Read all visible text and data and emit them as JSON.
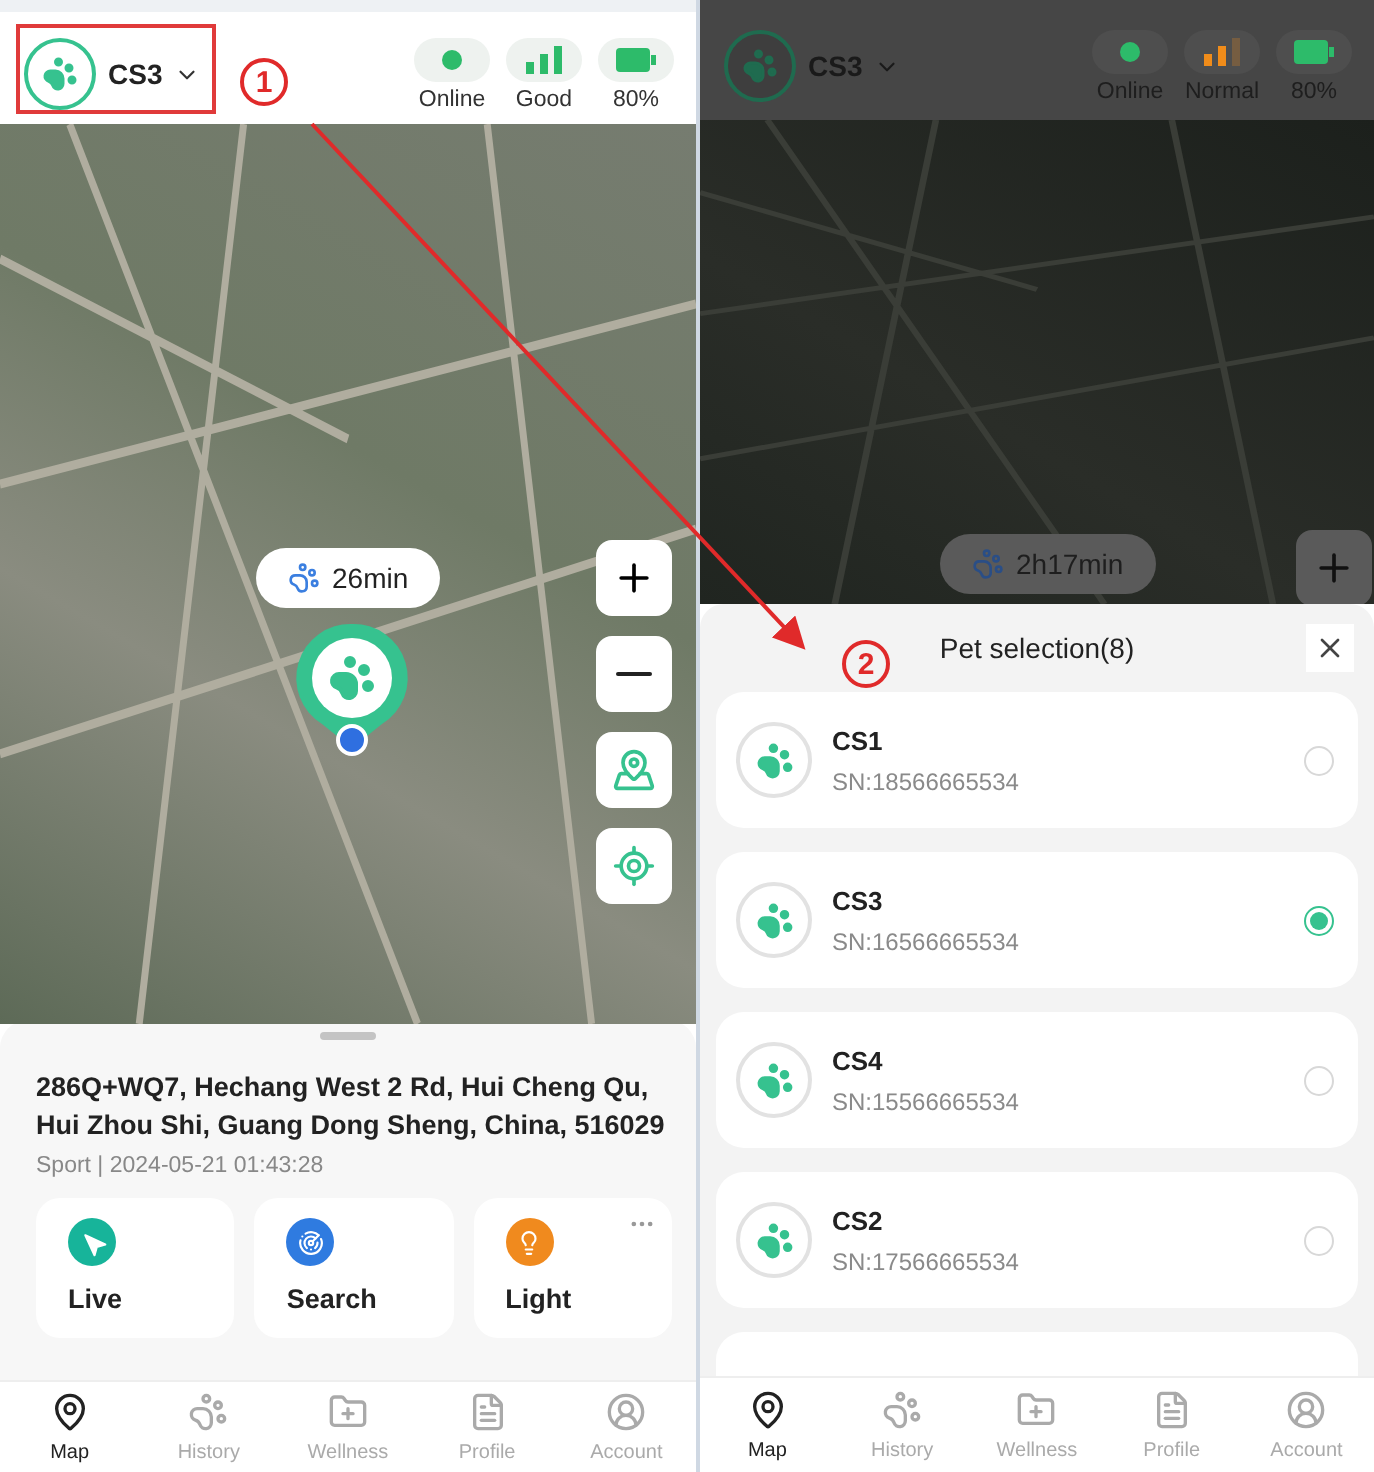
{
  "annotations": [
    {
      "label": "1"
    },
    {
      "label": "2"
    }
  ],
  "left_screen": {
    "header": {
      "pet_name": "CS3",
      "status": [
        {
          "kind": "dot",
          "label": "Online",
          "color": "#2dbb6a"
        },
        {
          "kind": "signal",
          "label": "Good",
          "color": "#2dbb6a"
        },
        {
          "kind": "battery",
          "label": "80%",
          "color": "#2dbb6a"
        }
      ]
    },
    "map": {
      "duration": "26min"
    },
    "sheet": {
      "address": "286Q+WQ7, Hechang West 2 Rd, Hui Cheng Qu, Hui Zhou Shi, Guang Dong Sheng, China, 516029",
      "meta": "Sport | 2024-05-21 01:43:28",
      "actions": [
        {
          "kind": "live",
          "label": "Live"
        },
        {
          "kind": "search",
          "label": "Search"
        },
        {
          "kind": "light",
          "label": "Light"
        }
      ]
    },
    "nav": [
      {
        "kind": "map",
        "label": "Map",
        "selected": true
      },
      {
        "kind": "history",
        "label": "History",
        "selected": false
      },
      {
        "kind": "wellness",
        "label": "Wellness",
        "selected": false
      },
      {
        "kind": "profile",
        "label": "Profile",
        "selected": false
      },
      {
        "kind": "account",
        "label": "Account",
        "selected": false
      }
    ]
  },
  "right_screen": {
    "header": {
      "pet_name": "CS3",
      "status": [
        {
          "kind": "dot",
          "label": "Online",
          "color": "#2dbb6a"
        },
        {
          "kind": "signal",
          "label": "Normal",
          "color": "#f08c1a"
        },
        {
          "kind": "battery",
          "label": "80%",
          "color": "#2dbb6a"
        }
      ]
    },
    "map": {
      "duration": "2h17min"
    },
    "dialog": {
      "title": "Pet selection(8)",
      "pets": [
        {
          "name": "CS1",
          "sn": "SN:18566665534",
          "selected": false
        },
        {
          "name": "CS3",
          "sn": "SN:16566665534",
          "selected": true
        },
        {
          "name": "CS4",
          "sn": "SN:15566665534",
          "selected": false
        },
        {
          "name": "CS2",
          "sn": "SN:17566665534",
          "selected": false
        }
      ]
    },
    "nav": [
      {
        "kind": "map",
        "label": "Map",
        "selected": true
      },
      {
        "kind": "history",
        "label": "History",
        "selected": false
      },
      {
        "kind": "wellness",
        "label": "Wellness",
        "selected": false
      },
      {
        "kind": "profile",
        "label": "Profile",
        "selected": false
      },
      {
        "kind": "account",
        "label": "Account",
        "selected": false
      }
    ]
  }
}
